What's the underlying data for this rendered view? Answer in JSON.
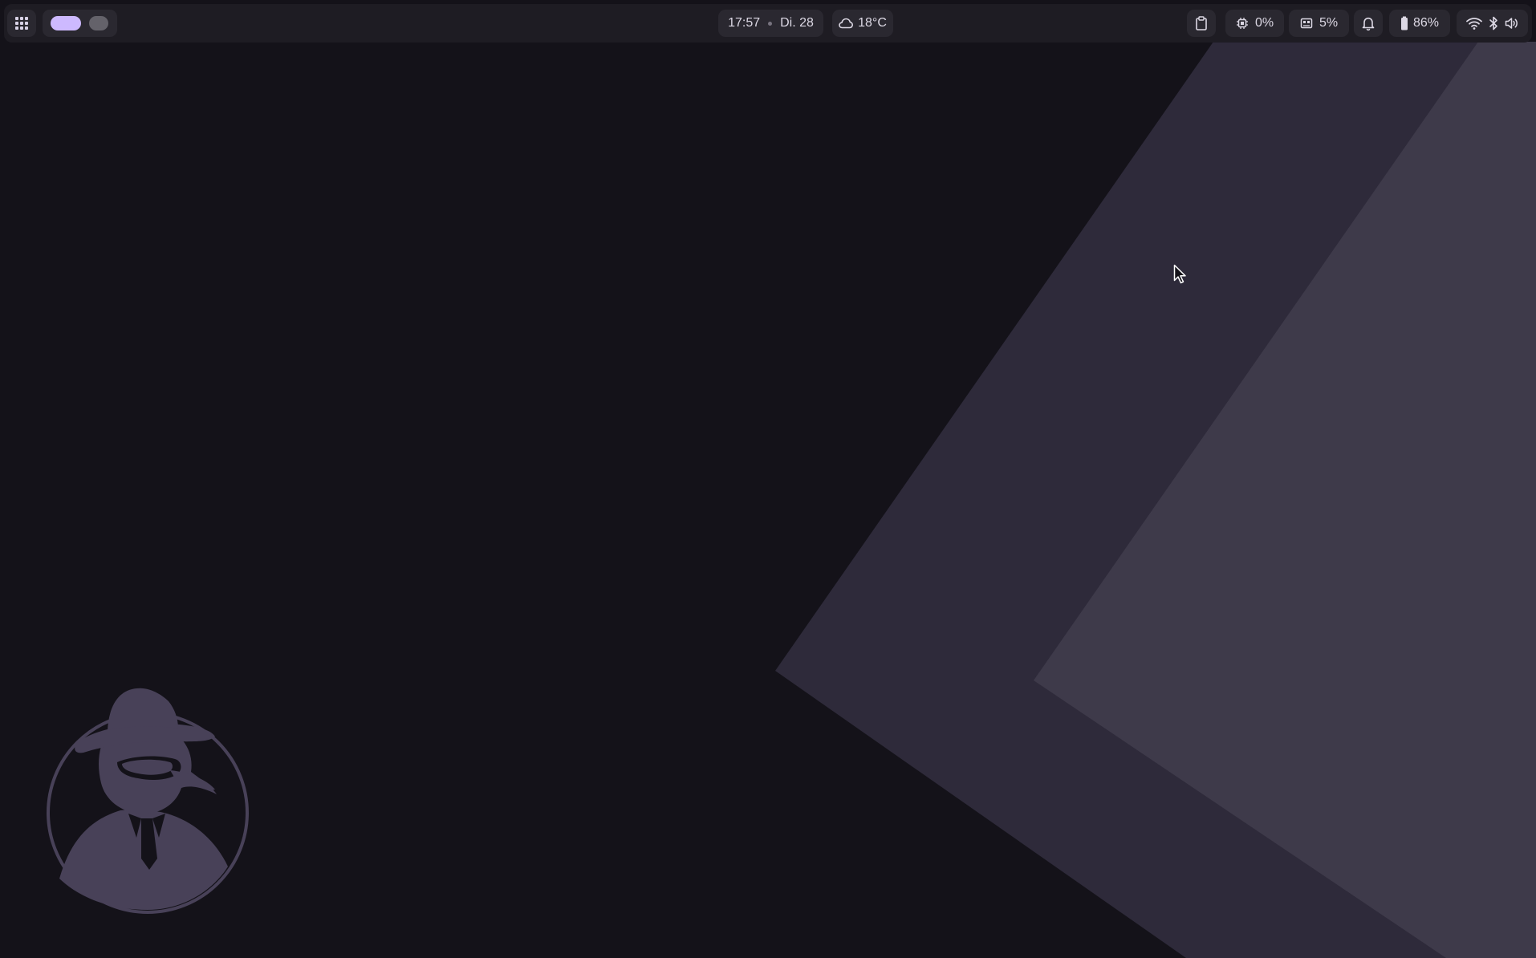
{
  "wallpaper": {
    "background_color": "#141219",
    "band_dark_color": "#2e2a3a",
    "band_light_color": "#3e3a4a",
    "logo_color": "#484158",
    "logo_icon": "spy-penguin-logo"
  },
  "topbar": {
    "apps_icon": "apps-grid-icon",
    "workspaces": [
      {
        "state": "active",
        "color": "#cdb9ff"
      },
      {
        "state": "occupied",
        "color": "#64626a"
      }
    ],
    "clock": {
      "time": "17:57",
      "date": "Di. 28"
    },
    "weather": {
      "icon": "cloud-icon",
      "temperature": "18°C"
    },
    "clipboard_icon": "clipboard-icon",
    "cpu": {
      "icon": "cpu-icon",
      "value": "0%"
    },
    "ram": {
      "icon": "memory-icon",
      "value": "5%"
    },
    "notifications_icon": "bell-icon",
    "battery": {
      "icon": "battery-icon",
      "value": "86%",
      "level": 0.86
    },
    "tray": {
      "wifi_icon": "wifi-icon",
      "bluetooth_icon": "bluetooth-icon",
      "volume_icon": "volume-icon"
    }
  },
  "cursor_icon": "mouse-pointer-icon"
}
